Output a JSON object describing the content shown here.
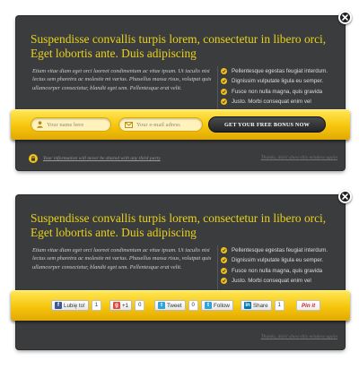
{
  "popup1": {
    "headline": "Suspendisse convallis turpis lorem, consectetur in libero orci, Eget lobortis ante. Duis adipiscing",
    "body": "Etiam vitae diam eget orci laoreet condimentum ac vitae ipsum. Ut iaculis nisi lectus sem pharetra ac molestie mi varius. Phasellus massa risus, volutpat quis ullamcorper consectetur, blandit eget sem. Pellentesque erat velit.",
    "bullets": [
      "Pellentesque egestas feugiat interdum.",
      "Dignissim vulputate ligula eu semper.",
      "Fusce non nulla magna, quis gravida",
      "Justo. Morbi consequat enim vel"
    ],
    "name_placeholder": "Your name here",
    "email_placeholder": "Your e-mail adress",
    "submit_label": "GET YOUR FREE BONUS NOW",
    "privacy_text": "Your information will never be shared with any third party",
    "dismiss_text": "Thanks, don't show this window again"
  },
  "popup2": {
    "headline": "Suspendisse convallis turpis lorem, consectetur in libero orci, Eget lobortis ante. Duis adipiscing",
    "body": "Etiam vitae diam eget orci laoreet condimentum ac vitae ipsum. Ut iaculis nisi lectus sem pharetra ac molestie mi varius. Phasellus massa risus, volutpat quis ullamcorper consectetur, blandit eget sem. Pellentesque erat velit.",
    "bullets": [
      "Pellentesque egestas feugiat interdum.",
      "Dignissim vulputate ligula eu semper.",
      "Fusce non nulla magna, quis gravida",
      "Justo. Morbi consequat enim vel"
    ],
    "social": {
      "facebook_label": "Lubię to!",
      "facebook_count": "1",
      "gplus_label": "+1",
      "gplus_count": "0",
      "tweet_label": "Tweet",
      "tweet_count": "0",
      "follow_label": "Follow",
      "linkedin_label": "Share",
      "linkedin_count": "1",
      "pinterest_label": "Pin it"
    },
    "dismiss_text": "Thanks, don't show this window again"
  },
  "colors": {
    "panel": "#3b3c3e",
    "headline": "#e8d21a",
    "band": "#f5c60c",
    "facebook": "#3b5998",
    "gplus": "#dd4b39",
    "twitter": "#2fa3dd",
    "linkedin": "#0077b5"
  }
}
